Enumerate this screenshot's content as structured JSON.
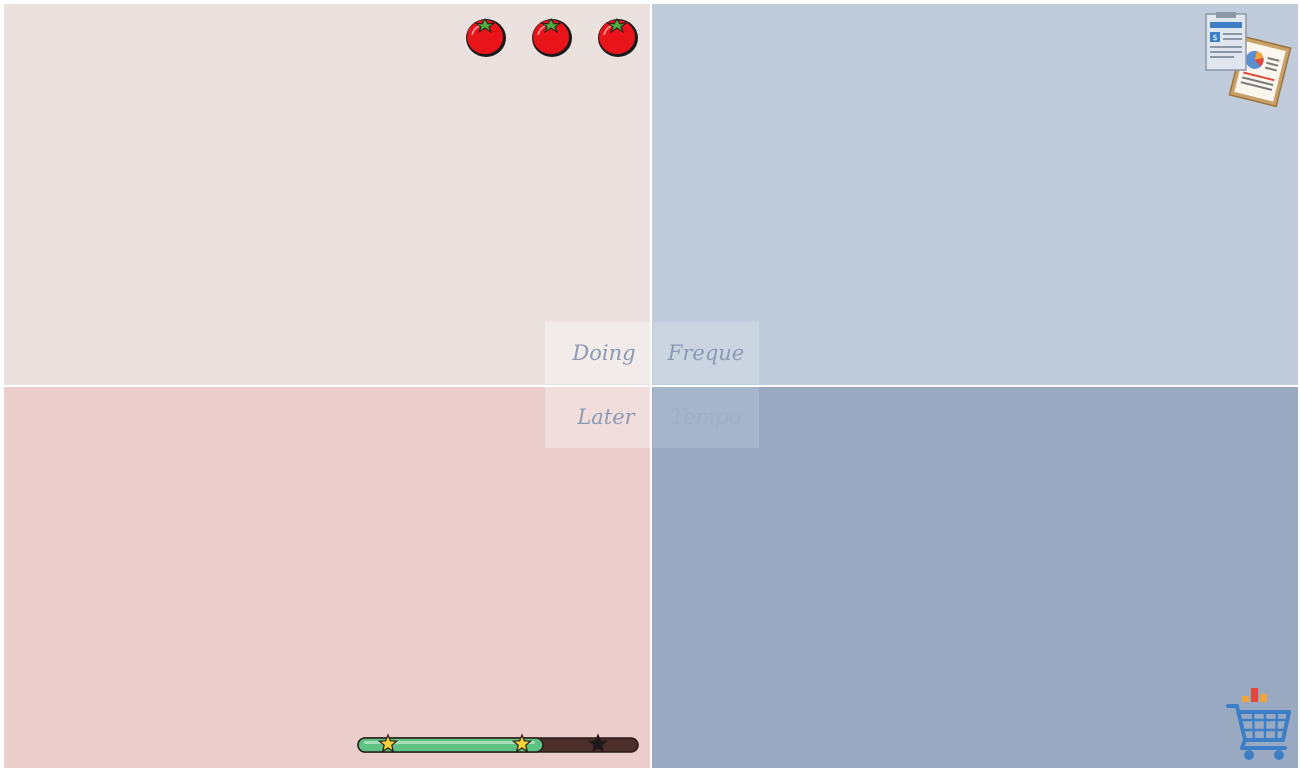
{
  "quadrants": {
    "top_left": {
      "color": "#ebe2df"
    },
    "top_right": {
      "color": "#c0ccdb"
    },
    "bottom_left": {
      "color": "#ebcecc"
    },
    "bottom_right": {
      "color": "#98a9c1"
    }
  },
  "tomatoes": {
    "icon": "tomato-icon",
    "count": 3,
    "color": "#e8141a"
  },
  "labels": {
    "doing": "Doing",
    "freque": "Freque",
    "later": "Later",
    "tempo": "Tempo"
  },
  "progress": {
    "value": 0.66,
    "fill_color": "#5ec382",
    "track_color": "#4a2f2a",
    "stars": [
      {
        "state": "earned"
      },
      {
        "state": "earned"
      },
      {
        "state": "unearned"
      }
    ]
  },
  "icons": {
    "report": "report-clipboard-icon",
    "cart": "shopping-cart-icon"
  }
}
